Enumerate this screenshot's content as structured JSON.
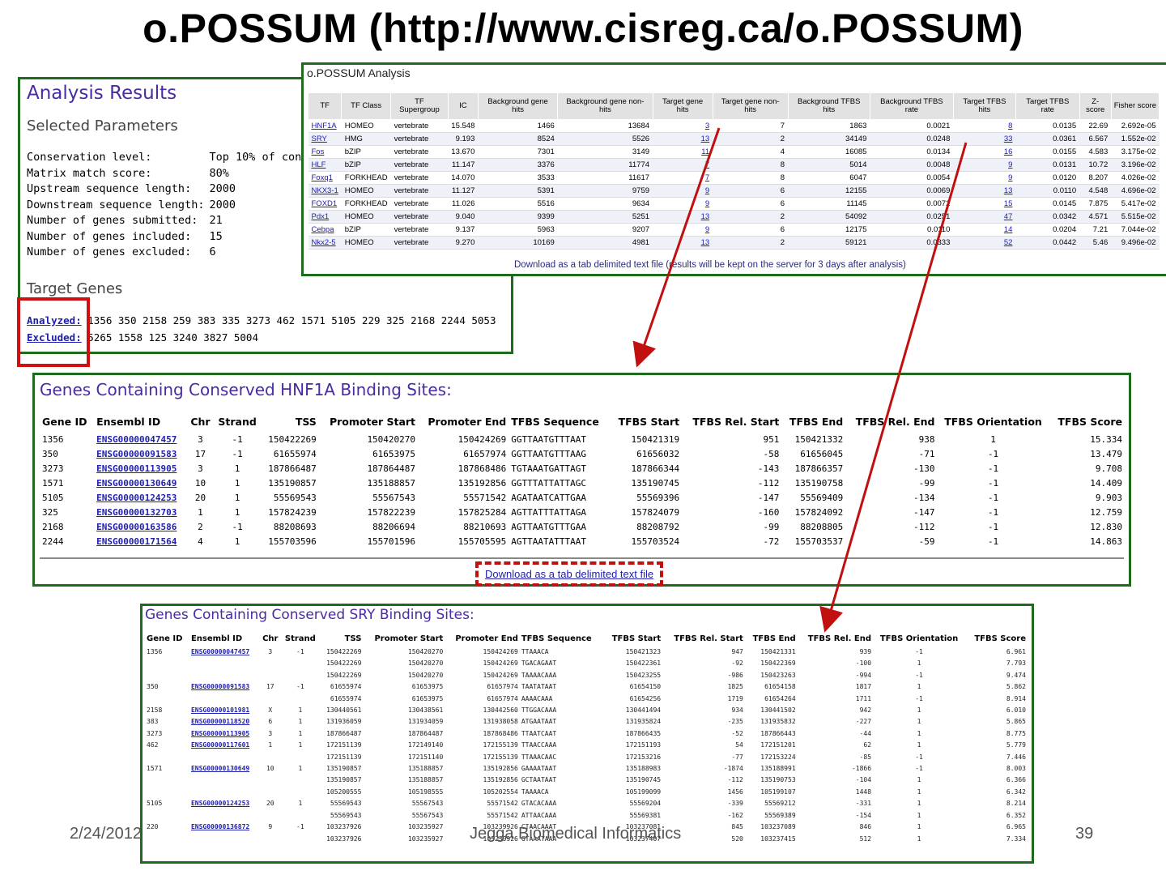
{
  "slide": {
    "title": "o.POSSUM (http://www.cisreg.ca/o.POSSUM)",
    "footer_date": "2/24/2012",
    "footer_center": "Jegga Biomedical Informatics",
    "page_number": "39"
  },
  "analysis_results": {
    "title": "Analysis Results",
    "selected_parameters_title": "Selected Parameters",
    "params": [
      {
        "label": "Conservation level:",
        "value": "Top 10% of cons"
      },
      {
        "label": "Matrix match score:",
        "value": "80%"
      },
      {
        "label": "Upstream sequence length:",
        "value": "2000"
      },
      {
        "label": "Downstream sequence length:",
        "value": "2000"
      },
      {
        "label": "Number of genes submitted:",
        "value": "21"
      },
      {
        "label": "Number of genes included:",
        "value": "15"
      },
      {
        "label": "Number of genes excluded:",
        "value": "6"
      }
    ],
    "target_genes_title": "Target Genes",
    "analyzed_label": "Analyzed:",
    "analyzed_list": "1356 350 2158 259 383 335 3273 462 1571 5105 229 325 2168 2244 5053",
    "excluded_label": "Excluded:",
    "excluded_list": "5265 1558 125 3240 3827 5004"
  },
  "opossum_analysis": {
    "caption": "o.POSSUM Analysis",
    "headers": [
      "TF",
      "TF Class",
      "TF Supergroup",
      "IC",
      "Background gene hits",
      "Background gene non-hits",
      "Target gene hits",
      "Target gene non-hits",
      "Background TFBS hits",
      "Background TFBS rate",
      "Target TFBS hits",
      "Target TFBS rate",
      "Z-score",
      "Fisher score"
    ],
    "rows": [
      [
        "HNF1A",
        "HOMEO",
        "vertebrate",
        "15.548",
        "1466",
        "13684",
        "3",
        "7",
        "1863",
        "0.0021",
        "8",
        "0.0135",
        "22.69",
        "2.692e-05"
      ],
      [
        "SRY",
        "HMG",
        "vertebrate",
        "9.193",
        "8524",
        "5526",
        "13",
        "2",
        "34149",
        "0.0248",
        "33",
        "0.0361",
        "6.567",
        "1.552e-02"
      ],
      [
        "Fos",
        "bZIP",
        "vertebrate",
        "13.670",
        "7301",
        "3149",
        "11",
        "4",
        "16085",
        "0.0134",
        "16",
        "0.0155",
        "4.583",
        "3.175e-02"
      ],
      [
        "HLF",
        "bZIP",
        "vertebrate",
        "11.147",
        "3376",
        "11774",
        "7",
        "8",
        "5014",
        "0.0048",
        "9",
        "0.0131",
        "10.72",
        "3.196e-02"
      ],
      [
        "Foxq1",
        "FORKHEAD",
        "vertebrate",
        "14.070",
        "3533",
        "11617",
        "7",
        "8",
        "6047",
        "0.0054",
        "9",
        "0.0120",
        "8.207",
        "4.026e-02"
      ],
      [
        "NKX3-1",
        "HOMEO",
        "vertebrate",
        "11.127",
        "5391",
        "9759",
        "9",
        "6",
        "12155",
        "0.0069",
        "13",
        "0.0110",
        "4.548",
        "4.696e-02"
      ],
      [
        "FOXD1",
        "FORKHEAD",
        "vertebrate",
        "11.026",
        "5516",
        "9634",
        "9",
        "6",
        "11145",
        "0.0072",
        "15",
        "0.0145",
        "7.875",
        "5.417e-02"
      ],
      [
        "Pdx1",
        "HOMEO",
        "vertebrate",
        "9.040",
        "9399",
        "5251",
        "13",
        "2",
        "54092",
        "0.0251",
        "47",
        "0.0342",
        "4.571",
        "5.515e-02"
      ],
      [
        "Cebpa",
        "bZIP",
        "vertebrate",
        "9.137",
        "5963",
        "9207",
        "9",
        "6",
        "12175",
        "0.0110",
        "14",
        "0.0204",
        "7.21",
        "7.044e-02"
      ],
      [
        "Nkx2-5",
        "HOMEO",
        "vertebrate",
        "9.270",
        "10169",
        "4981",
        "13",
        "2",
        "59121",
        "0.0333",
        "52",
        "0.0442",
        "5.46",
        "9.496e-02"
      ]
    ],
    "download_note": "Download as a tab delimited text file (results will be kept on the server for 3 days after analysis)"
  },
  "hnf1a": {
    "title": "Genes Containing Conserved HNF1A Binding Sites:",
    "headers": [
      "Gene ID",
      "Ensembl ID",
      "Chr",
      "Strand",
      "TSS",
      "Promoter Start",
      "Promoter End",
      "TFBS Sequence",
      "TFBS Start",
      "TFBS Rel. Start",
      "TFBS End",
      "TFBS Rel. End",
      "TFBS Orientation",
      "TFBS Score"
    ],
    "rows": [
      [
        "1356",
        "ENSG00000047457",
        "3",
        "-1",
        "150422269",
        "150420270",
        "150424269",
        "GGTTAATGTTTAAT",
        "150421319",
        "951",
        "150421332",
        "938",
        "1",
        "15.334"
      ],
      [
        "350",
        "ENSG00000091583",
        "17",
        "-1",
        "61655974",
        "61653975",
        "61657974",
        "GGTTAATGTTTAAG",
        "61656032",
        "-58",
        "61656045",
        "-71",
        "-1",
        "13.479"
      ],
      [
        "3273",
        "ENSG00000113905",
        "3",
        "1",
        "187866487",
        "187864487",
        "187868486",
        "TGTAAATGATTAGT",
        "187866344",
        "-143",
        "187866357",
        "-130",
        "-1",
        "9.708"
      ],
      [
        "1571",
        "ENSG00000130649",
        "10",
        "1",
        "135190857",
        "135188857",
        "135192856",
        "GGTTTATTATTAGC",
        "135190745",
        "-112",
        "135190758",
        "-99",
        "-1",
        "14.409"
      ],
      [
        "5105",
        "ENSG00000124253",
        "20",
        "1",
        "55569543",
        "55567543",
        "55571542",
        "AGATAATCATTGAA",
        "55569396",
        "-147",
        "55569409",
        "-134",
        "-1",
        "9.903"
      ],
      [
        "325",
        "ENSG00000132703",
        "1",
        "1",
        "157824239",
        "157822239",
        "157825284",
        "AGTTATTTATTAGA",
        "157824079",
        "-160",
        "157824092",
        "-147",
        "-1",
        "12.759"
      ],
      [
        "2168",
        "ENSG00000163586",
        "2",
        "-1",
        "88208693",
        "88206694",
        "88210693",
        "AGTTAATGTTTGAA",
        "88208792",
        "-99",
        "88208805",
        "-112",
        "-1",
        "12.830"
      ],
      [
        "2244",
        "ENSG00000171564",
        "4",
        "1",
        "155703596",
        "155701596",
        "155705595",
        "AGTTAATATTTAAT",
        "155703524",
        "-72",
        "155703537",
        "-59",
        "-1",
        "14.863"
      ]
    ],
    "download_label": "Download as a tab delimited text file"
  },
  "sry": {
    "title": "Genes Containing Conserved SRY Binding Sites:",
    "headers": [
      "Gene ID",
      "Ensembl ID",
      "Chr",
      "Strand",
      "TSS",
      "Promoter Start",
      "Promoter End",
      "TFBS Sequence",
      "TFBS Start",
      "TFBS Rel. Start",
      "TFBS End",
      "TFBS Rel. End",
      "TFBS Orientation",
      "TFBS Score"
    ],
    "rows": [
      [
        "1356",
        "ENSG00000047457",
        "3",
        "-1",
        "150422269",
        "150420270",
        "150424269",
        "TTAAACA",
        "150421323",
        "947",
        "150421331",
        "939",
        "-1",
        "6.961"
      ],
      [
        "",
        "",
        "",
        "",
        "150422269",
        "150420270",
        "150424269",
        "TGACAGAAT",
        "150422361",
        "-92",
        "150422369",
        "-100",
        "1",
        "7.793"
      ],
      [
        "",
        "",
        "",
        "",
        "150422269",
        "150420270",
        "150424269",
        "TAAAACAAA",
        "150423255",
        "-986",
        "150423263",
        "-994",
        "-1",
        "9.474"
      ],
      [
        "350",
        "ENSG00000091583",
        "17",
        "-1",
        "61655974",
        "61653975",
        "61657974",
        "TAATATAAT",
        "61654150",
        "1825",
        "61654158",
        "1817",
        "1",
        "5.862"
      ],
      [
        "",
        "",
        "",
        "",
        "61655974",
        "61653975",
        "61657974",
        "AAAACAAA",
        "61654256",
        "1719",
        "61654264",
        "1711",
        "-1",
        "8.914"
      ],
      [
        "2158",
        "ENSG00000101981",
        "X",
        "1",
        "130440561",
        "130438561",
        "130442560",
        "TTGGACAAA",
        "130441494",
        "934",
        "130441502",
        "942",
        "1",
        "6.010"
      ],
      [
        "383",
        "ENSG00000118520",
        "6",
        "1",
        "131936059",
        "131934059",
        "131938058",
        "ATGAATAAT",
        "131935824",
        "-235",
        "131935832",
        "-227",
        "1",
        "5.865"
      ],
      [
        "3273",
        "ENSG00000113905",
        "3",
        "1",
        "187866487",
        "187864487",
        "187868486",
        "TTAATCAAT",
        "187866435",
        "-52",
        "187866443",
        "-44",
        "1",
        "8.775"
      ],
      [
        "462",
        "ENSG00000117601",
        "1",
        "1",
        "172151139",
        "172149140",
        "172155139",
        "TTAACCAAA",
        "172151193",
        "54",
        "172151201",
        "62",
        "1",
        "5.779"
      ],
      [
        "",
        "",
        "",
        "",
        "172151139",
        "172151140",
        "172155139",
        "TTAAACAAC",
        "172153216",
        "-77",
        "172153224",
        "-85",
        "-1",
        "7.446"
      ],
      [
        "1571",
        "ENSG00000130649",
        "10",
        "1",
        "135190857",
        "135188857",
        "135192856",
        "GAAAATAAT",
        "135188983",
        "-1874",
        "135188991",
        "-1866",
        "-1",
        "8.003"
      ],
      [
        "",
        "",
        "",
        "",
        "135190857",
        "135188857",
        "135192856",
        "GCTAATAAT",
        "135190745",
        "-112",
        "135190753",
        "-104",
        "1",
        "6.366"
      ],
      [
        "",
        "",
        "",
        "",
        "105200555",
        "105198555",
        "105202554",
        "TAAAACA",
        "105199099",
        "1456",
        "105199107",
        "1448",
        "1",
        "6.342"
      ],
      [
        "5105",
        "ENSG00000124253",
        "20",
        "1",
        "55569543",
        "55567543",
        "55571542",
        "GTACACAAA",
        "55569204",
        "-339",
        "55569212",
        "-331",
        "1",
        "8.214"
      ],
      [
        "",
        "",
        "",
        "",
        "55569543",
        "55567543",
        "55571542",
        "ATTAACAAA",
        "55569381",
        "-162",
        "55569389",
        "-154",
        "1",
        "6.352"
      ],
      [
        "220",
        "ENSG00000136872",
        "9",
        "-1",
        "103237926",
        "103235927",
        "103239926",
        "CTAACAAAT",
        "103237081",
        "845",
        "103237089",
        "846",
        "1",
        "6.965"
      ],
      [
        "",
        "",
        "",
        "",
        "103237926",
        "103235927",
        "103239926",
        "GTAAATAAA",
        "103237407",
        "520",
        "103237415",
        "512",
        "1",
        "7.334"
      ]
    ]
  }
}
